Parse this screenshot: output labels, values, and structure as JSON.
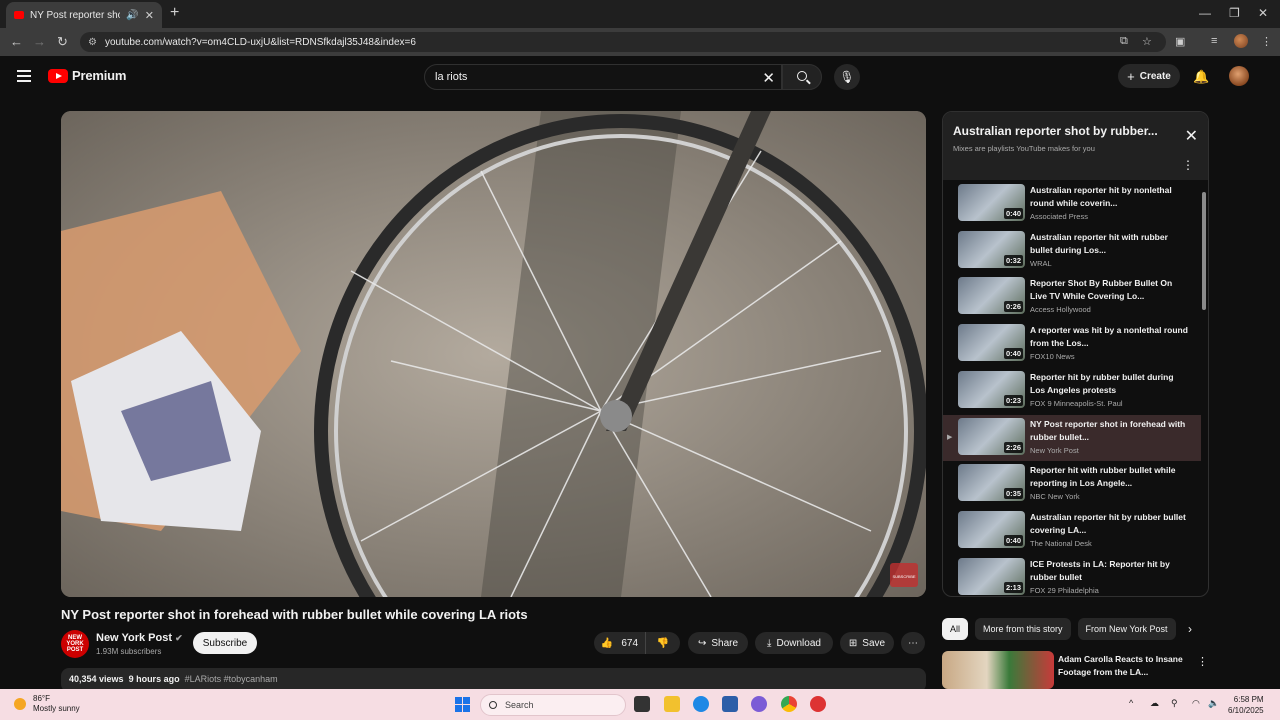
{
  "browser": {
    "tab_title": "NY Post reporter shot in fo",
    "url": "youtube.com/watch?v=om4CLD-uxjU&list=RDNSfkdajl35J48&index=6",
    "new_tab": "+"
  },
  "header": {
    "logo_text": "Premium",
    "search_query": "la riots",
    "create_label": "Create"
  },
  "video": {
    "title": "NY Post reporter shot in forehead with rubber bullet while covering LA riots",
    "channel": "New York Post",
    "channel_avatar_text": "NEW YORK POST",
    "subscribers": "1.93M subscribers",
    "subscribe_label": "Subscribe",
    "likes": "674",
    "share_label": "Share",
    "download_label": "Download",
    "save_label": "Save",
    "views": "40,354 views",
    "age": "9 hours ago",
    "tags": "#LARiots #tobycanham",
    "watermark": "SUBSCRIBE"
  },
  "playlist": {
    "title": "Australian reporter shot by rubber...",
    "subtitle": "Mixes are playlists YouTube makes for you",
    "items": [
      {
        "title": "Australian reporter hit by nonlethal round while coverin...",
        "channel": "Associated Press",
        "duration": "0:40"
      },
      {
        "title": "Australian reporter hit with rubber bullet during Los...",
        "channel": "WRAL",
        "duration": "0:32"
      },
      {
        "title": "Reporter Shot By Rubber Bullet On Live TV While Covering Lo...",
        "channel": "Access Hollywood",
        "duration": "0:26"
      },
      {
        "title": "A reporter was hit by a nonlethal round from the Los...",
        "channel": "FOX10 News",
        "duration": "0:40"
      },
      {
        "title": "Reporter hit by rubber bullet during Los Angeles protests",
        "channel": "FOX 9 Minneapolis-St. Paul",
        "duration": "0:23"
      },
      {
        "title": "NY Post reporter shot in forehead with rubber bullet...",
        "channel": "New York Post",
        "duration": "2:26"
      },
      {
        "title": "Reporter hit with rubber bullet while reporting in Los Angele...",
        "channel": "NBC New York",
        "duration": "0:35"
      },
      {
        "title": "Australian reporter hit by rubber bullet covering LA...",
        "channel": "The National Desk",
        "duration": "0:40"
      },
      {
        "title": "ICE Protests in LA: Reporter hit by rubber bullet",
        "channel": "FOX 29 Philadelphia",
        "duration": "2:13"
      }
    ]
  },
  "chips": [
    "All",
    "More from this story",
    "From New York Post"
  ],
  "recommendation": {
    "title": "Adam Carolla Reacts to Insane Footage from the LA..."
  },
  "taskbar": {
    "temperature": "86°F",
    "weather": "Mostly sunny",
    "search_placeholder": "Search",
    "time": "6:58 PM",
    "date": "6/10/2025"
  },
  "colors": {
    "youtube_red": "#ff0000",
    "background": "#0f0f0f",
    "active_item": "#3a2a2b"
  }
}
